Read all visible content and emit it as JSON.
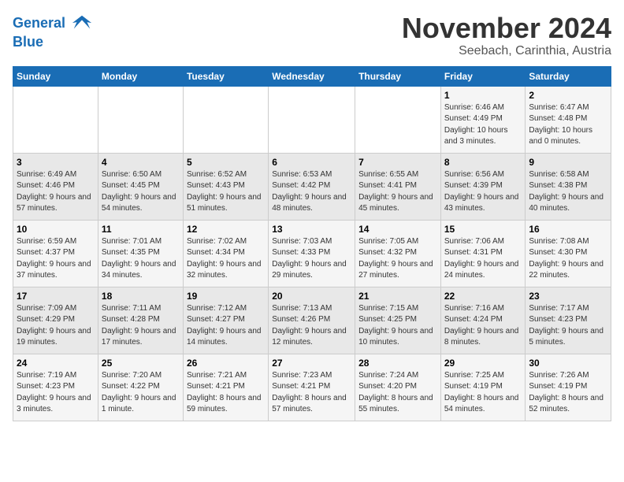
{
  "logo": {
    "line1": "General",
    "line2": "Blue"
  },
  "header": {
    "title": "November 2024",
    "location": "Seebach, Carinthia, Austria"
  },
  "weekdays": [
    "Sunday",
    "Monday",
    "Tuesday",
    "Wednesday",
    "Thursday",
    "Friday",
    "Saturday"
  ],
  "weeks": [
    [
      {
        "day": "",
        "info": ""
      },
      {
        "day": "",
        "info": ""
      },
      {
        "day": "",
        "info": ""
      },
      {
        "day": "",
        "info": ""
      },
      {
        "day": "",
        "info": ""
      },
      {
        "day": "1",
        "info": "Sunrise: 6:46 AM\nSunset: 4:49 PM\nDaylight: 10 hours and 3 minutes."
      },
      {
        "day": "2",
        "info": "Sunrise: 6:47 AM\nSunset: 4:48 PM\nDaylight: 10 hours and 0 minutes."
      }
    ],
    [
      {
        "day": "3",
        "info": "Sunrise: 6:49 AM\nSunset: 4:46 PM\nDaylight: 9 hours and 57 minutes."
      },
      {
        "day": "4",
        "info": "Sunrise: 6:50 AM\nSunset: 4:45 PM\nDaylight: 9 hours and 54 minutes."
      },
      {
        "day": "5",
        "info": "Sunrise: 6:52 AM\nSunset: 4:43 PM\nDaylight: 9 hours and 51 minutes."
      },
      {
        "day": "6",
        "info": "Sunrise: 6:53 AM\nSunset: 4:42 PM\nDaylight: 9 hours and 48 minutes."
      },
      {
        "day": "7",
        "info": "Sunrise: 6:55 AM\nSunset: 4:41 PM\nDaylight: 9 hours and 45 minutes."
      },
      {
        "day": "8",
        "info": "Sunrise: 6:56 AM\nSunset: 4:39 PM\nDaylight: 9 hours and 43 minutes."
      },
      {
        "day": "9",
        "info": "Sunrise: 6:58 AM\nSunset: 4:38 PM\nDaylight: 9 hours and 40 minutes."
      }
    ],
    [
      {
        "day": "10",
        "info": "Sunrise: 6:59 AM\nSunset: 4:37 PM\nDaylight: 9 hours and 37 minutes."
      },
      {
        "day": "11",
        "info": "Sunrise: 7:01 AM\nSunset: 4:35 PM\nDaylight: 9 hours and 34 minutes."
      },
      {
        "day": "12",
        "info": "Sunrise: 7:02 AM\nSunset: 4:34 PM\nDaylight: 9 hours and 32 minutes."
      },
      {
        "day": "13",
        "info": "Sunrise: 7:03 AM\nSunset: 4:33 PM\nDaylight: 9 hours and 29 minutes."
      },
      {
        "day": "14",
        "info": "Sunrise: 7:05 AM\nSunset: 4:32 PM\nDaylight: 9 hours and 27 minutes."
      },
      {
        "day": "15",
        "info": "Sunrise: 7:06 AM\nSunset: 4:31 PM\nDaylight: 9 hours and 24 minutes."
      },
      {
        "day": "16",
        "info": "Sunrise: 7:08 AM\nSunset: 4:30 PM\nDaylight: 9 hours and 22 minutes."
      }
    ],
    [
      {
        "day": "17",
        "info": "Sunrise: 7:09 AM\nSunset: 4:29 PM\nDaylight: 9 hours and 19 minutes."
      },
      {
        "day": "18",
        "info": "Sunrise: 7:11 AM\nSunset: 4:28 PM\nDaylight: 9 hours and 17 minutes."
      },
      {
        "day": "19",
        "info": "Sunrise: 7:12 AM\nSunset: 4:27 PM\nDaylight: 9 hours and 14 minutes."
      },
      {
        "day": "20",
        "info": "Sunrise: 7:13 AM\nSunset: 4:26 PM\nDaylight: 9 hours and 12 minutes."
      },
      {
        "day": "21",
        "info": "Sunrise: 7:15 AM\nSunset: 4:25 PM\nDaylight: 9 hours and 10 minutes."
      },
      {
        "day": "22",
        "info": "Sunrise: 7:16 AM\nSunset: 4:24 PM\nDaylight: 9 hours and 8 minutes."
      },
      {
        "day": "23",
        "info": "Sunrise: 7:17 AM\nSunset: 4:23 PM\nDaylight: 9 hours and 5 minutes."
      }
    ],
    [
      {
        "day": "24",
        "info": "Sunrise: 7:19 AM\nSunset: 4:23 PM\nDaylight: 9 hours and 3 minutes."
      },
      {
        "day": "25",
        "info": "Sunrise: 7:20 AM\nSunset: 4:22 PM\nDaylight: 9 hours and 1 minute."
      },
      {
        "day": "26",
        "info": "Sunrise: 7:21 AM\nSunset: 4:21 PM\nDaylight: 8 hours and 59 minutes."
      },
      {
        "day": "27",
        "info": "Sunrise: 7:23 AM\nSunset: 4:21 PM\nDaylight: 8 hours and 57 minutes."
      },
      {
        "day": "28",
        "info": "Sunrise: 7:24 AM\nSunset: 4:20 PM\nDaylight: 8 hours and 55 minutes."
      },
      {
        "day": "29",
        "info": "Sunrise: 7:25 AM\nSunset: 4:19 PM\nDaylight: 8 hours and 54 minutes."
      },
      {
        "day": "30",
        "info": "Sunrise: 7:26 AM\nSunset: 4:19 PM\nDaylight: 8 hours and 52 minutes."
      }
    ]
  ]
}
